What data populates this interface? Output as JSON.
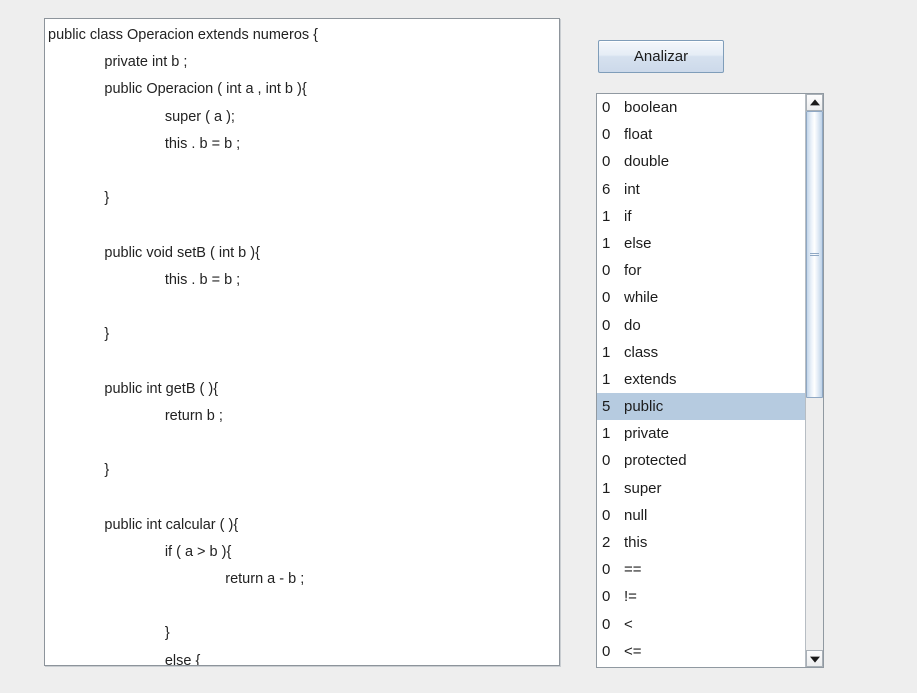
{
  "editor": {
    "name": "source-code-editor",
    "code": "public class Operacion extends numeros {\n              private int b ;\n              public Operacion ( int a , int b ){\n                             super ( a );\n                             this . b = b ;\n\n              }\n\n              public void setB ( int b ){\n                             this . b = b ;\n\n              }\n\n              public int getB ( ){\n                             return b ;\n\n              }\n\n              public int calcular ( ){\n                             if ( a > b ){\n                                            return a - b ;\n\n                             }\n                             else {\n                                            return a + b ;\n\n                             }\n\n              }\n\n}"
  },
  "toolbar": {
    "analyze_label": "Analizar"
  },
  "token_list": {
    "selected_index": 11,
    "rows": [
      {
        "count": "0",
        "token": "boolean"
      },
      {
        "count": "0",
        "token": "float"
      },
      {
        "count": "0",
        "token": "double"
      },
      {
        "count": "6",
        "token": "int"
      },
      {
        "count": "1",
        "token": "if"
      },
      {
        "count": "1",
        "token": "else"
      },
      {
        "count": "0",
        "token": "for"
      },
      {
        "count": "0",
        "token": "while"
      },
      {
        "count": "0",
        "token": "do"
      },
      {
        "count": "1",
        "token": "class"
      },
      {
        "count": "1",
        "token": "extends"
      },
      {
        "count": "5",
        "token": "public"
      },
      {
        "count": "1",
        "token": "private"
      },
      {
        "count": "0",
        "token": "protected"
      },
      {
        "count": "1",
        "token": "super"
      },
      {
        "count": "0",
        "token": "null"
      },
      {
        "count": "2",
        "token": "this"
      },
      {
        "count": "0",
        "token": "=="
      },
      {
        "count": "0",
        "token": "!="
      },
      {
        "count": "0",
        "token": "<"
      },
      {
        "count": "0",
        "token": "<="
      }
    ]
  },
  "scrollbar": {
    "up_arrow": "scroll-up-arrow-icon",
    "down_arrow": "scroll-down-arrow-icon"
  },
  "colors": {
    "selection": "#b6cbe0",
    "panel_background": "#eeeeee",
    "field_background": "#ffffff",
    "border": "#8d949b",
    "button_border": "#7f9db9"
  }
}
